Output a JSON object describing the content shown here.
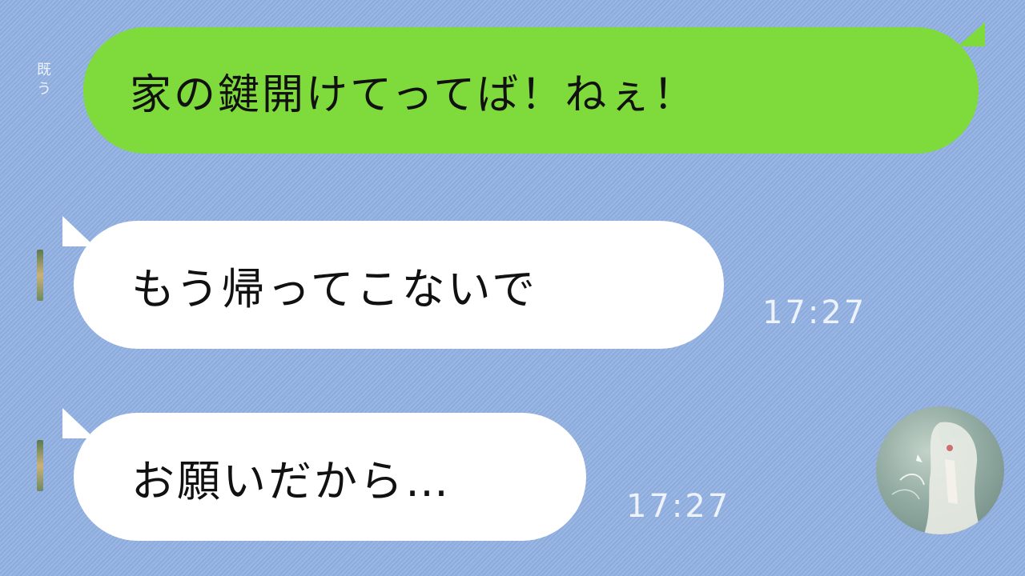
{
  "chat": {
    "messages": [
      {
        "sender": "me",
        "text": "家の鍵開けてってば！ねぇ！",
        "bubble_color": "#7fda3c"
      },
      {
        "sender": "other",
        "text": "もう帰ってこないで",
        "time": "17:27",
        "bubble_color": "#ffffff"
      },
      {
        "sender": "other",
        "text": "お願いだから…",
        "time": "17:27",
        "bubble_color": "#ffffff"
      }
    ]
  },
  "read_indicator_fragment": "既\nう",
  "colors": {
    "background": "#8faee0",
    "timestamp": "#eef3fb"
  },
  "icons": [
    "contact-avatar-icon"
  ]
}
